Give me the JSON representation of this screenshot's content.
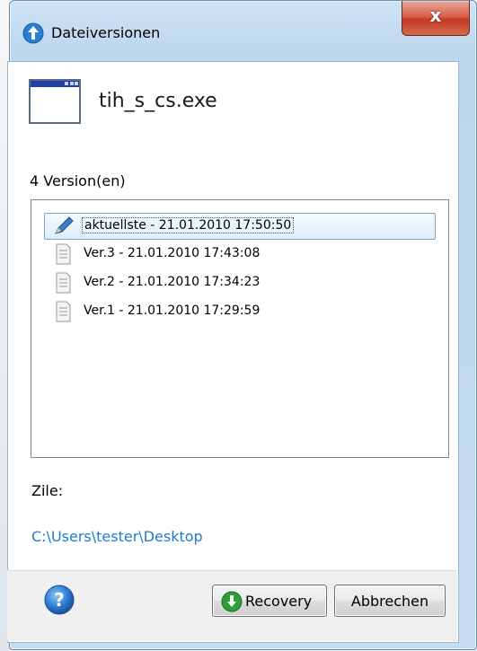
{
  "window": {
    "title": "Dateiversionen",
    "close_label": "x"
  },
  "file": {
    "name": "tih_s_cs.exe"
  },
  "versions": {
    "count_label": "4 Version(en)",
    "items": [
      {
        "label": "aktuellste - 21.01.2010 17:50:50",
        "icon": "pencil-icon",
        "selected": true
      },
      {
        "label": "Ver.3 - 21.01.2010 17:43:08",
        "icon": "document-icon",
        "selected": false
      },
      {
        "label": "Ver.2 - 21.01.2010 17:34:23",
        "icon": "document-icon",
        "selected": false
      },
      {
        "label": "Ver.1 - 21.01.2010 17:29:59",
        "icon": "document-icon",
        "selected": false
      }
    ]
  },
  "target": {
    "label": "Zile:",
    "path": "C:\\Users\\tester\\Desktop"
  },
  "footer": {
    "help_icon": "help-icon",
    "recovery_label": "Recovery",
    "cancel_label": "Abbrechen"
  },
  "colors": {
    "link": "#1f7ad0",
    "close_button": "#c33a22",
    "selection": "#dfeefb"
  }
}
